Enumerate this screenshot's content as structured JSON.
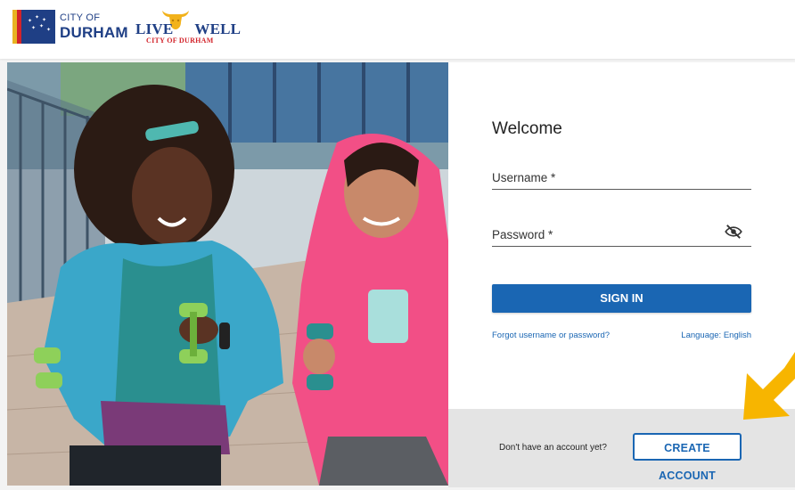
{
  "header": {
    "city_logo_top": "CITY OF",
    "city_logo_bottom": "DURHAM",
    "livewell_word1": "LIVE",
    "livewell_word2": "WELL",
    "livewell_sub": "CITY OF DURHAM"
  },
  "login": {
    "title": "Welcome",
    "username_label": "Username *",
    "password_label": "Password *",
    "signin_label": "SIGN IN",
    "forgot_link": "Forgot username or password?",
    "language_link": "Language: English"
  },
  "footer": {
    "no_account_text": "Don't have an account yet?",
    "create_account_label": "CREATE ACCOUNT"
  },
  "colors": {
    "brand_blue": "#1a66b3",
    "durham_navy": "#1f3f85",
    "accent_red": "#d2232a",
    "arrow_yellow": "#f7b500"
  },
  "icons": [
    "visibility-off-icon",
    "bull-logo-icon",
    "pointer-arrow-icon"
  ]
}
